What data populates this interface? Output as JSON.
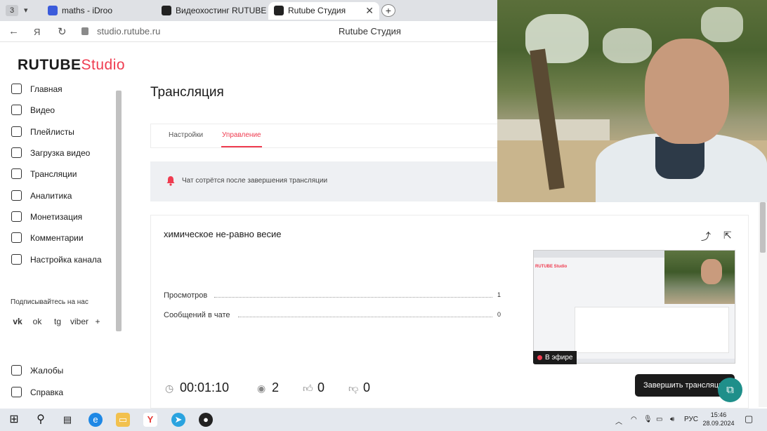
{
  "browser": {
    "tab_count": "3",
    "tabs": [
      {
        "label": "maths - iDroo",
        "fav_color": "#3b5bdb"
      },
      {
        "label": "Видеохостинг RUTUBE. С",
        "fav_color": "#222222"
      },
      {
        "label": "Rutube Студия",
        "fav_color": "#222222"
      }
    ],
    "new_tab": "+",
    "close": "✕",
    "url": "studio.rutube.ru",
    "page_title": "Rutube Студия"
  },
  "sidebar": {
    "logo_main": "RUTUBE",
    "logo_sub": "Studio",
    "items": [
      {
        "label": "Главная",
        "icon": "home-icon"
      },
      {
        "label": "Видео",
        "icon": "video-icon"
      },
      {
        "label": "Плейлисты",
        "icon": "playlist-icon"
      },
      {
        "label": "Загрузка видео",
        "icon": "upload-icon"
      },
      {
        "label": "Трансляции",
        "icon": "broadcast-icon"
      },
      {
        "label": "Аналитика",
        "icon": "analytics-icon"
      },
      {
        "label": "Монетизация",
        "icon": "monetization-icon"
      },
      {
        "label": "Комментарии",
        "icon": "comments-icon"
      },
      {
        "label": "Настройка канала",
        "icon": "channel-settings-icon"
      }
    ],
    "subscribe_label": "Подписывайтесь на нас",
    "social": [
      "vk",
      "ok",
      "tg",
      "viber",
      "+"
    ],
    "bottom_items": [
      {
        "label": "Жалобы",
        "icon": "complaints-icon"
      },
      {
        "label": "Справка",
        "icon": "help-icon"
      }
    ]
  },
  "main": {
    "title": "Трансляция",
    "tabs": [
      {
        "label": "Настройки"
      },
      {
        "label": "Управление"
      }
    ],
    "alert_text": "Чат сотрётся после завершения трансляции",
    "stream": {
      "name": "химическое не-равно весие",
      "stats": [
        {
          "label": "Просмотров",
          "value": "1"
        },
        {
          "label": "Сообщений в чате",
          "value": "0"
        }
      ],
      "live_badge": "В эфире",
      "duration": "00:01:10",
      "viewers": "2",
      "likes": "0",
      "dislikes": "0",
      "end_button": "Завершить трансляцию"
    }
  },
  "taskbar": {
    "lang": "РУС",
    "time": "15:46",
    "date": "28.09.2024"
  },
  "colors": {
    "accent": "#ef3c50",
    "chat_fab": "#1f8f8a"
  }
}
